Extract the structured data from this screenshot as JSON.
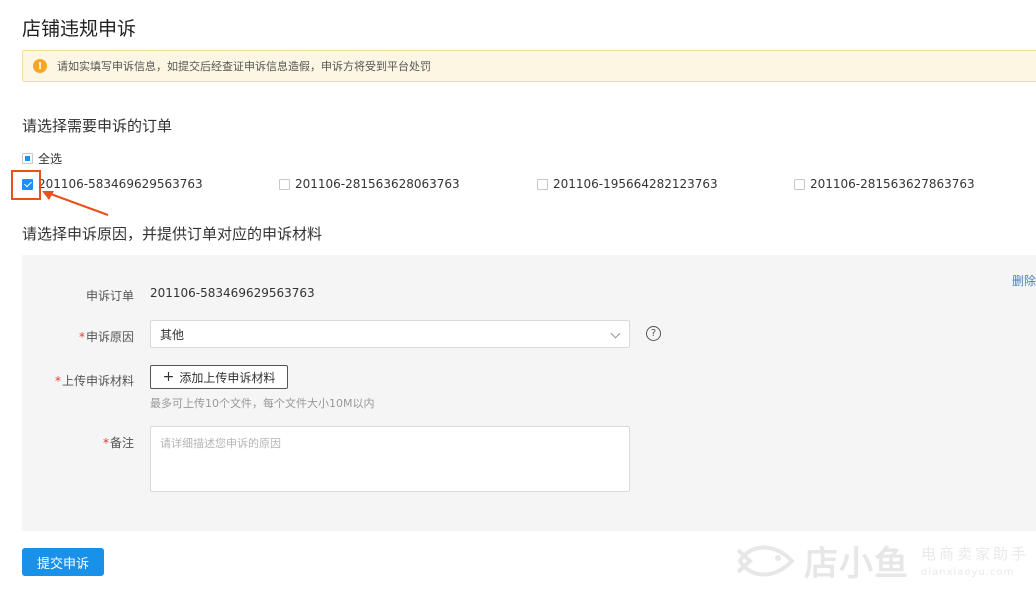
{
  "page": {
    "title": "店铺违规申诉"
  },
  "alert": {
    "icon": "warning-icon",
    "text": "请如实填写申诉信息，如提交后经查证申诉信息造假，申诉方将受到平台处罚"
  },
  "order_section": {
    "title": "请选择需要申诉的订单",
    "select_all_label": "全选",
    "orders": [
      {
        "id": "201106-583469629563763",
        "checked": true
      },
      {
        "id": "201106-281563628063763",
        "checked": false
      },
      {
        "id": "201106-195664282123763",
        "checked": false
      },
      {
        "id": "201106-281563627863763",
        "checked": false
      }
    ]
  },
  "reason_section": {
    "title": "请选择申诉原因，并提供订单对应的申诉材料",
    "delete_label": "删除",
    "order_label": "申诉订单",
    "order_value": "201106-583469629563763",
    "reason_label": "申诉原因",
    "reason_value": "其他",
    "upload_label": "上传申诉材料",
    "upload_button": "添加上传申诉材料",
    "upload_hint": "最多可上传10个文件，每个文件大小10M以内",
    "remark_label": "备注",
    "remark_placeholder": "请详细描述您申诉的原因",
    "required_mark": "*"
  },
  "submit": {
    "label": "提交申诉"
  },
  "watermark": {
    "cn": "电商卖家助手",
    "en": "dianxiaoyu.com",
    "brand": "店小鱼"
  },
  "colors": {
    "primary": "#1a91e8",
    "alert_bg": "#fdf6e3",
    "annotation": "#e8501e",
    "link": "#4a7fc1"
  }
}
